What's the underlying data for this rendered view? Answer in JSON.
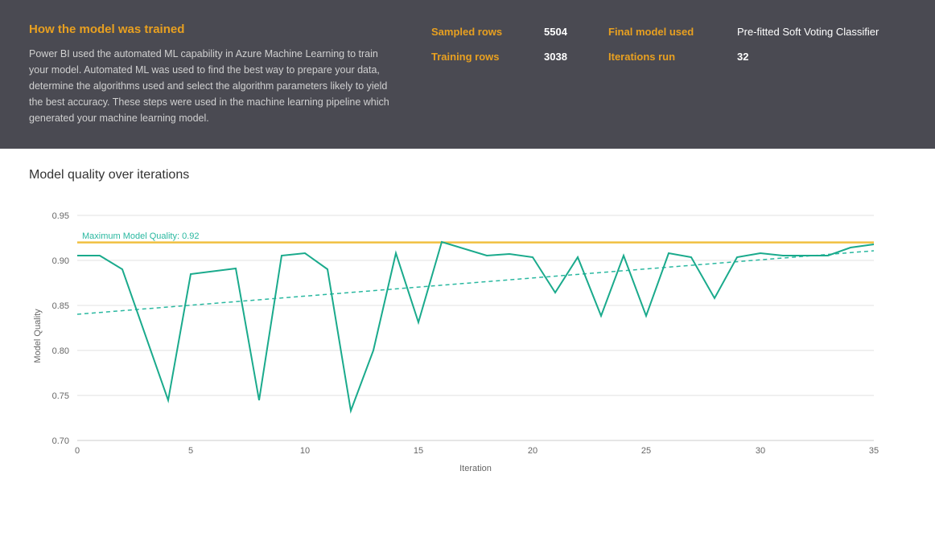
{
  "top_panel": {
    "title": "How the model was trained",
    "description": "Power BI used the automated ML capability in Azure Machine Learning to train your model. Automated ML was used to find the best way to prepare your data, determine the algorithms used and select the algorithm parameters likely to yield the best accuracy. These steps were used in the machine learning pipeline which generated your machine learning model.",
    "stats": {
      "sampled_rows_label": "Sampled rows",
      "sampled_rows_value": "5504",
      "training_rows_label": "Training rows",
      "training_rows_value": "3038",
      "final_model_label": "Final model used",
      "final_model_value": "Pre-fitted Soft Voting Classifier",
      "iterations_label": "Iterations run",
      "iterations_value": "32"
    }
  },
  "chart": {
    "title": "Model quality over iterations",
    "y_axis_label": "Model Quality",
    "x_axis_label": "Iteration",
    "max_quality_label": "Maximum Model Quality: 0.92",
    "y_ticks": [
      "0.95",
      "0.90",
      "0.85",
      "0.80",
      "0.75",
      "0.70"
    ],
    "x_ticks": [
      "0",
      "5",
      "10",
      "15",
      "20",
      "25",
      "30",
      "35"
    ]
  }
}
